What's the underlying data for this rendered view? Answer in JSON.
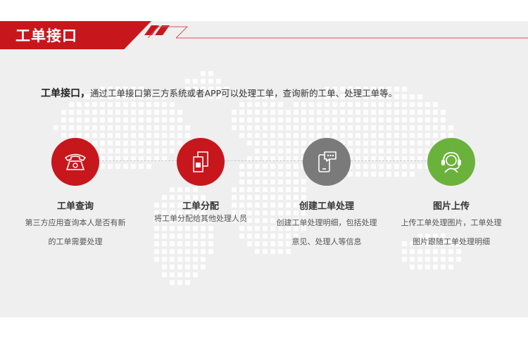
{
  "header": {
    "title": "工单接口"
  },
  "intro": {
    "bold": "工单接口，",
    "text": "通过工单接口第三方系统或者APP可以处理工单，查询新的工单、处理工单等。"
  },
  "colors": {
    "accent_red": "#c8161d",
    "gray": "#7a7a7a",
    "green": "#6ab23c"
  },
  "features": [
    {
      "title": "工单查询",
      "desc_lines": [
        "第三方应用查询本人是否有新",
        "的工单需要处理"
      ],
      "icon": "telephone-icon",
      "color": "#c8161d"
    },
    {
      "title": "工单分配",
      "desc_lines": [
        "将工单分配给其他处理人员",
        ""
      ],
      "icon": "sim-cards-icon",
      "color": "#c8161d"
    },
    {
      "title": "创建工单处理",
      "desc_lines": [
        "创建工单处理明细，包括处理",
        "意见、处理人等信息"
      ],
      "icon": "mobile-chat-icon",
      "color": "#7a7a7a"
    },
    {
      "title": "图片上传",
      "desc_lines": [
        "上传工单处理图片，工单处理",
        "图片跟随工单处理明细"
      ],
      "icon": "headset-icon",
      "color": "#6ab23c"
    }
  ]
}
